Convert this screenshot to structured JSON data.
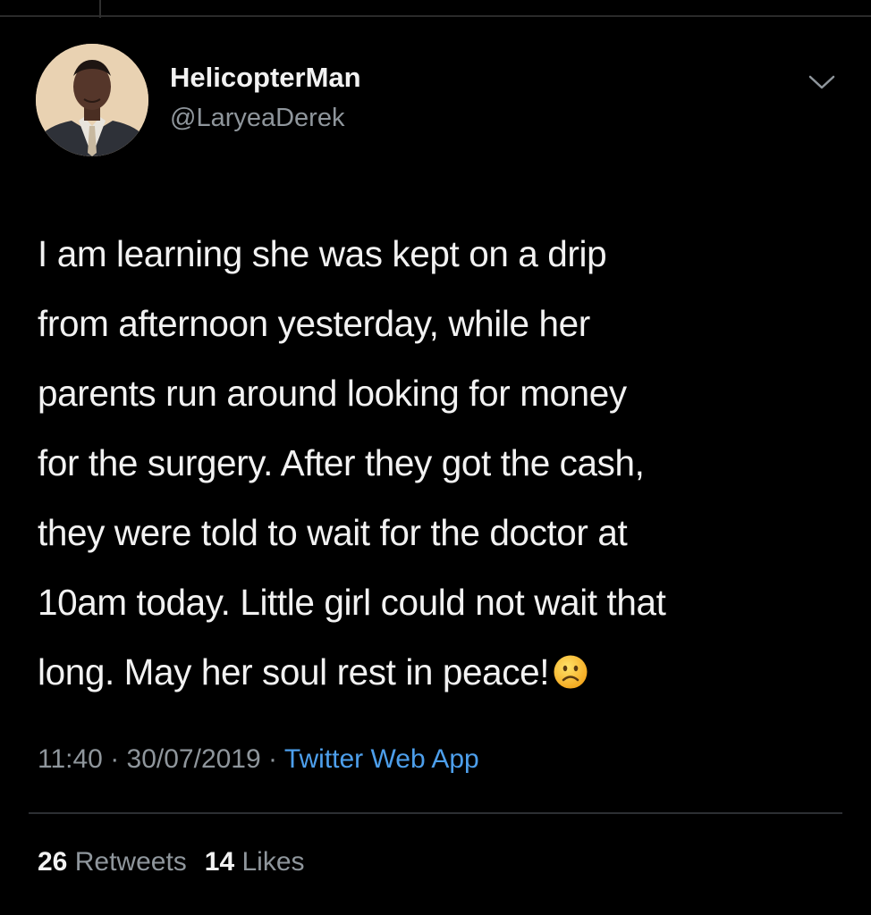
{
  "tweet": {
    "author": {
      "display_name": "HelicopterMan",
      "handle": "@LaryeaDerek"
    },
    "text_lines": [
      "I am learning she was kept on a drip",
      "from afternoon yesterday, while her",
      "parents run around looking for money",
      "for the surgery. After they got the cash,",
      "they were told to wait for the doctor at",
      "10am today. Little girl could not wait that",
      "long. May her soul rest in peace!"
    ],
    "emoji": "frowning-face",
    "time": "11:40",
    "separator": " · ",
    "date": "30/07/2019",
    "source": "Twitter Web App",
    "retweets_count": "26",
    "retweets_label": "Retweets",
    "likes_count": "14",
    "likes_label": "Likes"
  },
  "colors": {
    "background": "#000000",
    "text": "#f2f2f2",
    "muted": "#8f969c",
    "link": "#4d9fec",
    "divider": "#2c2f33"
  },
  "icons": {
    "menu": "chevron-down-icon",
    "avatar": "profile-photo"
  }
}
